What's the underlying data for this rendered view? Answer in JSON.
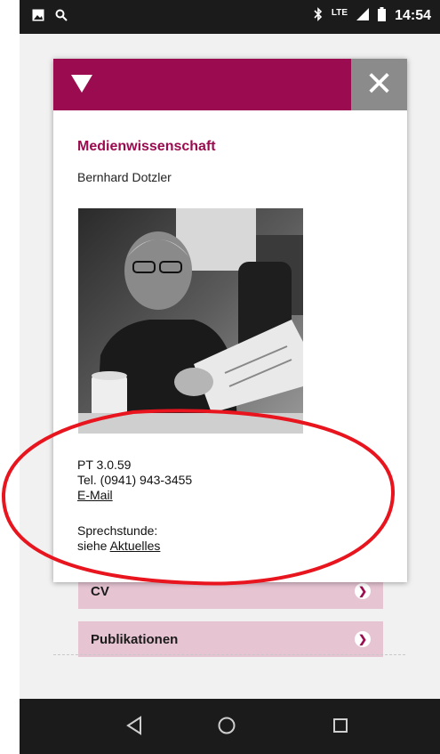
{
  "status_bar": {
    "time": "14:54",
    "network": "LTE"
  },
  "modal": {
    "department": "Medienwissenschaft",
    "person": "Bernhard Dotzler",
    "room": "PT 3.0.59",
    "phone": "Tel. (0941) 943-3455",
    "email_link": "E-Mail",
    "office_hours_label": "Sprechstunde:",
    "office_hours_prefix": "siehe",
    "office_hours_link": "Aktuelles"
  },
  "page": {
    "buttons": [
      {
        "label": "CV"
      },
      {
        "label": "Publikationen"
      }
    ]
  },
  "colors": {
    "accent": "#9b0b4f",
    "button_bg": "#e6c4d2",
    "annotation": "#e8141e"
  },
  "icons": [
    "image-icon",
    "search-icon",
    "bluetooth-icon",
    "signal-icon",
    "battery-icon",
    "triangle-down-icon",
    "close-icon",
    "chevron-right-icon",
    "back-icon",
    "home-icon",
    "recents-icon"
  ]
}
